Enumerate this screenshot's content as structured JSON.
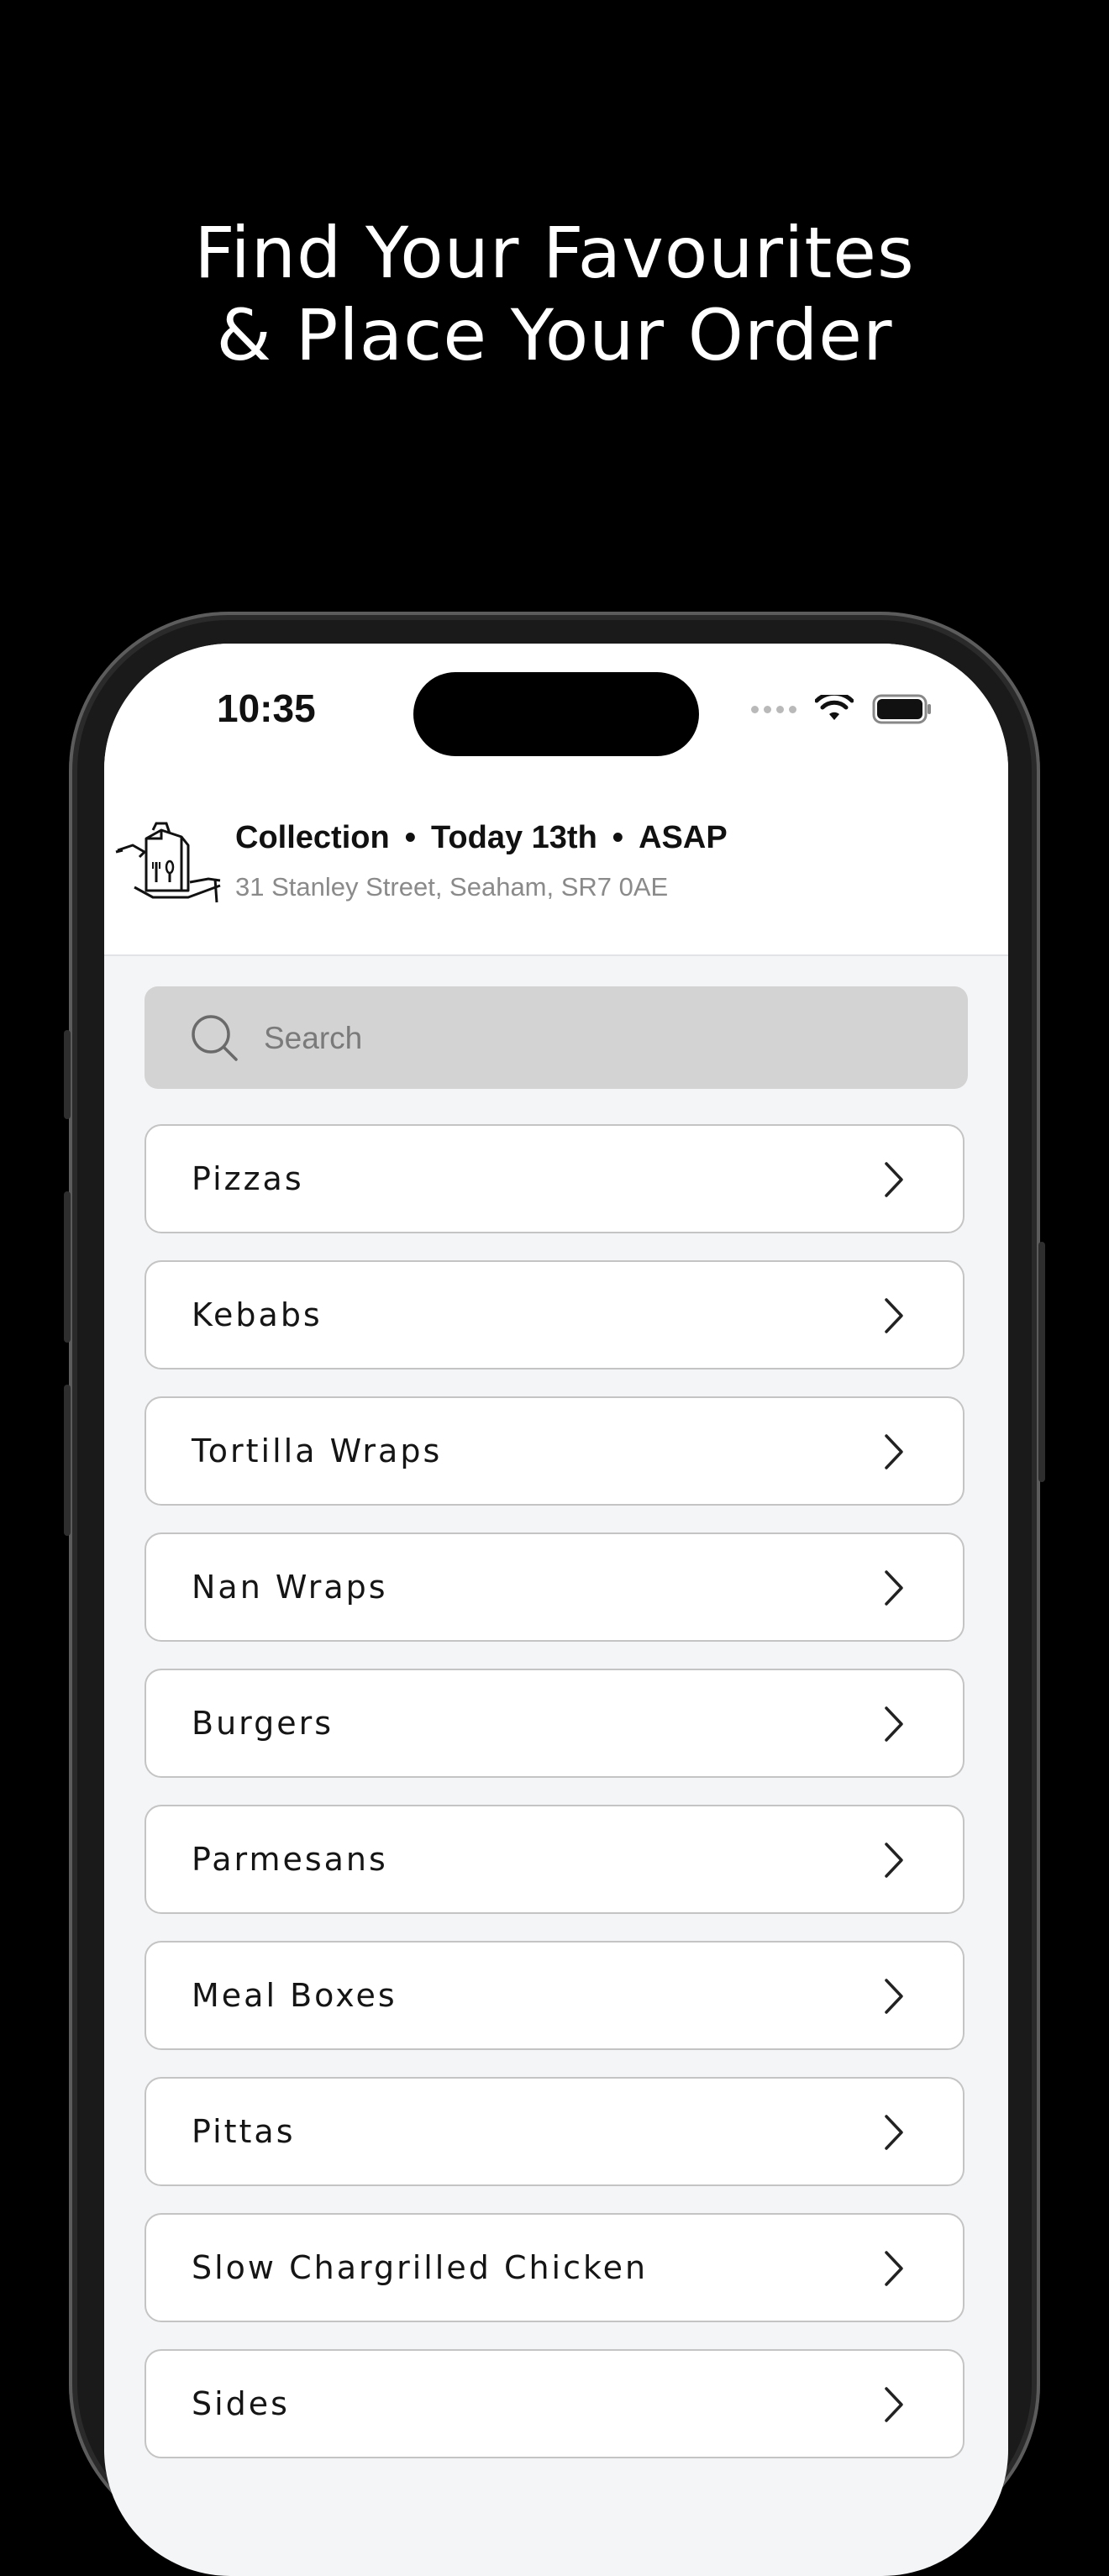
{
  "promo": {
    "line1": "Find Your Favourites",
    "line2": "& Place Your Order"
  },
  "status_bar": {
    "time": "10:35"
  },
  "header": {
    "order_type": "Collection",
    "day": "Today 13th",
    "timing": "ASAP",
    "separator": "•",
    "address": "31 Stanley Street, Seaham, SR7  0AE"
  },
  "search": {
    "placeholder": "Search"
  },
  "categories": [
    {
      "label": "Pizzas"
    },
    {
      "label": "Kebabs"
    },
    {
      "label": "Tortilla Wraps"
    },
    {
      "label": "Nan Wraps"
    },
    {
      "label": "Burgers"
    },
    {
      "label": "Parmesans"
    },
    {
      "label": "Meal Boxes"
    },
    {
      "label": "Pittas"
    },
    {
      "label": "Slow Chargrilled Chicken"
    },
    {
      "label": "Sides"
    }
  ],
  "colors": {
    "background": "#000000",
    "screen_background": "#f4f5f7",
    "search_background": "#d3d3d3",
    "card_border": "#c4c4c4"
  }
}
